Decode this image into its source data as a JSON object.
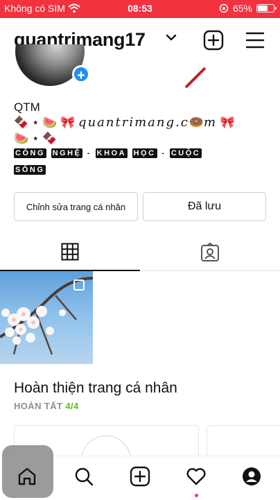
{
  "status_bar": {
    "carrier": "Không có SIM",
    "time": "08:53",
    "battery_percent": "65%",
    "battery_level": 0.65,
    "color": "#f2323f"
  },
  "header": {
    "username": "quantrimang17",
    "icons": [
      "chevron-down-icon",
      "new-post-icon",
      "menu-icon"
    ]
  },
  "profile": {
    "avatar_add_symbol": "+",
    "bio_name": "QTM",
    "bio_line1_prefix": "🍫 ⋆ 🍉 🎀 ",
    "bio_line1_fancy": "quantrimang.c",
    "bio_line1_mid": "🍩",
    "bio_line1_fancy_end": "m",
    "bio_line1_suffix": " 🎀",
    "bio_line2": "🍉 ⋆ 🍫",
    "bio_boxed_line1": [
      "CÔNG",
      "NGHỆ",
      "-",
      "KHOA",
      "HỌC",
      "-",
      "CUỘC"
    ],
    "bio_boxed_line2": [
      "SỐNG"
    ]
  },
  "buttons": {
    "edit_profile": "Chỉnh sửa trang cá nhân",
    "saved": "Đã lưu"
  },
  "tabs": {
    "items": [
      "grid-icon",
      "tagged-icon"
    ],
    "active": "grid-icon"
  },
  "completion": {
    "title": "Hoàn thiện trang cá nhân",
    "status_label": "HOÀN TẤT",
    "progress": "4/4",
    "progress_color": "#58c322"
  },
  "bottom_nav": {
    "items": [
      "home-icon",
      "search-icon",
      "create-icon",
      "activity-icon",
      "profile-icon"
    ],
    "active": "home-icon",
    "notification_dot_color": "#f0385c"
  }
}
